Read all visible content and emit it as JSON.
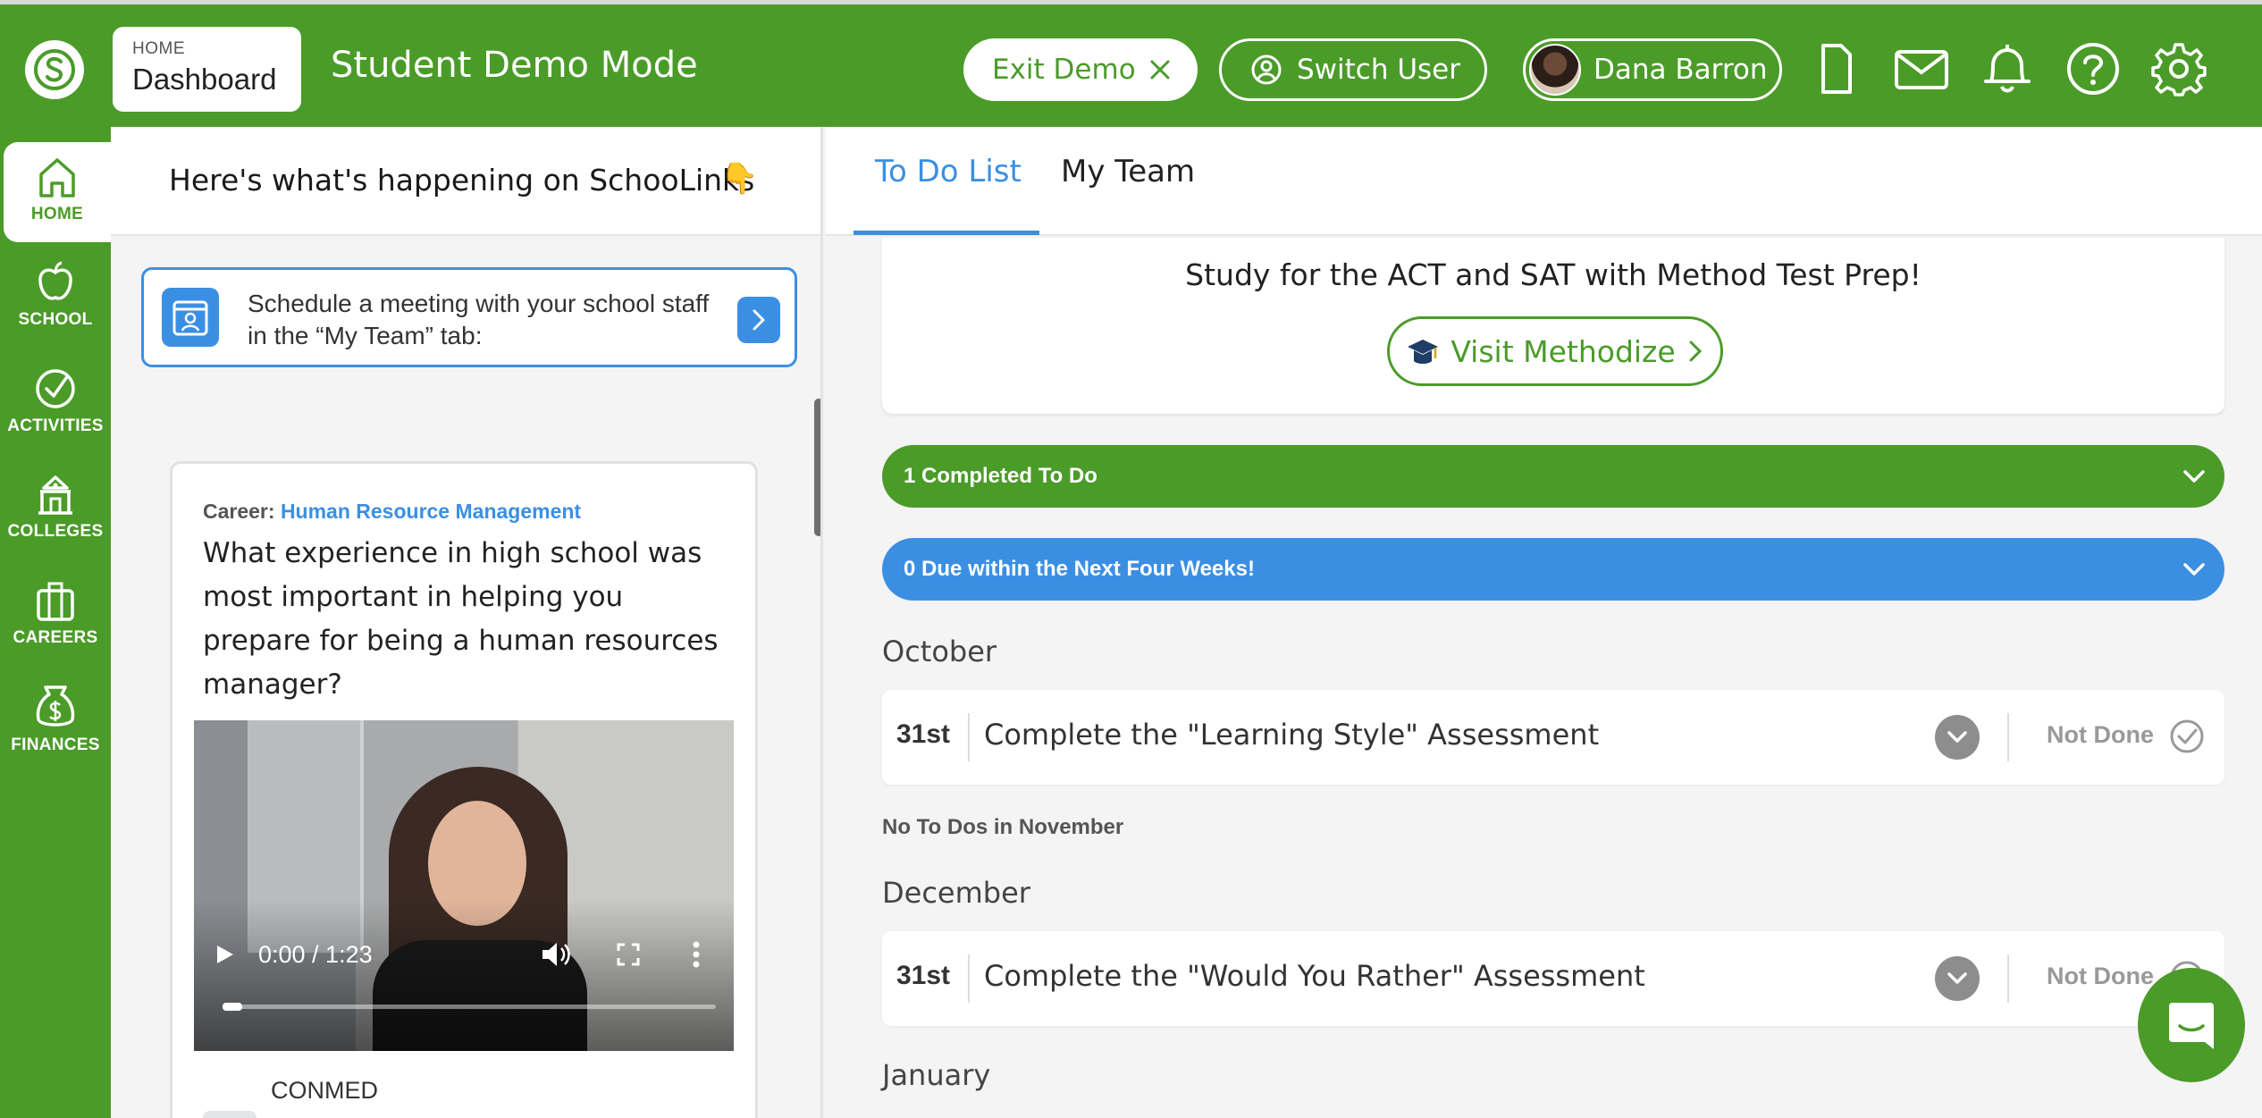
{
  "colors": {
    "brand_green": "#4b9b29",
    "accent_blue": "#3b8fe3",
    "status_gray": "#999999"
  },
  "topbar": {
    "breadcrumb_small": "HOME",
    "breadcrumb_big": "Dashboard",
    "mode_title": "Student Demo Mode",
    "exit_label": "Exit Demo",
    "switch_label": "Switch User",
    "user_name": "Dana Barron",
    "icons": [
      "document-icon",
      "mail-icon",
      "bell-icon",
      "help-icon",
      "gear-icon"
    ]
  },
  "sidebar": {
    "items": [
      {
        "label": "HOME",
        "icon": "home-icon",
        "active": true
      },
      {
        "label": "SCHOOL",
        "icon": "apple-icon"
      },
      {
        "label": "ACTIVITIES",
        "icon": "check-circle-icon"
      },
      {
        "label": "COLLEGES",
        "icon": "building-icon"
      },
      {
        "label": "CAREERS",
        "icon": "briefcase-icon"
      },
      {
        "label": "FINANCES",
        "icon": "money-bag-icon"
      }
    ]
  },
  "feed": {
    "header": "Here's what's happening on SchooLinks",
    "header_emoji": "👇",
    "schedule_text": "Schedule a meeting with your school staff in the “My Team” tab:",
    "card": {
      "career_prefix": "Career:",
      "career_link": "Human Resource Management",
      "question": "What experience in high school was most important in helping you prepare for being a human resources manager?",
      "video_time": "0:00 / 1:23",
      "source": "CONMED"
    }
  },
  "todo": {
    "tabs": [
      {
        "label": "To Do List",
        "active": true
      },
      {
        "label": "My Team"
      }
    ],
    "prep_text": "Study for the ACT and SAT with Method Test Prep!",
    "methodize_label": "Visit Methodize",
    "completed_bar": "1 Completed To Do",
    "due_bar": "0 Due within the Next Four Weeks!",
    "months": [
      {
        "name": "October",
        "items": [
          {
            "date": "31st",
            "title": "Complete the \"Learning Style\" Assessment",
            "status": "Not Done"
          }
        ]
      },
      {
        "empty_text": "No To Dos in November"
      },
      {
        "name": "December",
        "items": [
          {
            "date": "31st",
            "title": "Complete the \"Would You Rather\" Assessment",
            "status": "Not Done"
          }
        ]
      },
      {
        "name": "January"
      }
    ]
  }
}
